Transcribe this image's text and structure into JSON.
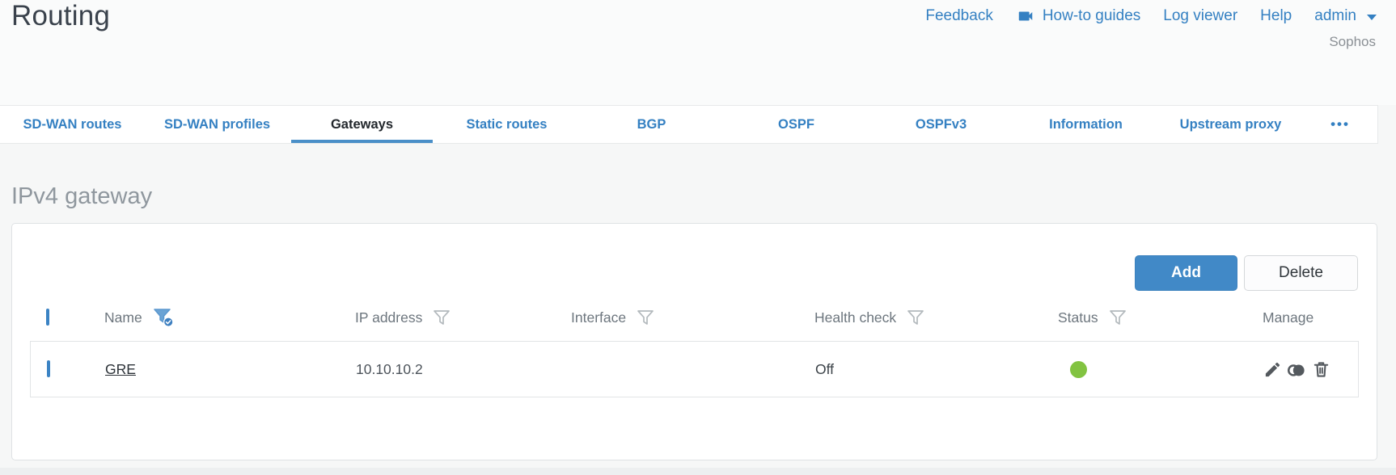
{
  "header": {
    "title": "Routing",
    "links": {
      "feedback": "Feedback",
      "howto": "How-to guides",
      "logviewer": "Log viewer",
      "help": "Help"
    },
    "user": "admin",
    "brand": "Sophos"
  },
  "tabs": {
    "items": [
      {
        "label": "SD-WAN routes",
        "active": false
      },
      {
        "label": "SD-WAN profiles",
        "active": false
      },
      {
        "label": "Gateways",
        "active": true
      },
      {
        "label": "Static routes",
        "active": false
      },
      {
        "label": "BGP",
        "active": false
      },
      {
        "label": "OSPF",
        "active": false
      },
      {
        "label": "OSPFv3",
        "active": false
      },
      {
        "label": "Information",
        "active": false
      },
      {
        "label": "Upstream proxy",
        "active": false
      }
    ],
    "more": "•••"
  },
  "section_title": "IPv4 gateway",
  "toolbar": {
    "add_label": "Add",
    "delete_label": "Delete"
  },
  "table": {
    "columns": [
      {
        "label": "Name",
        "filter": "active"
      },
      {
        "label": "IP address",
        "filter": "default"
      },
      {
        "label": "Interface",
        "filter": "default"
      },
      {
        "label": "Health check",
        "filter": "default"
      },
      {
        "label": "Status",
        "filter": "default"
      },
      {
        "label": "Manage",
        "filter": "none"
      }
    ],
    "rows": [
      {
        "name": "GRE",
        "ip_address": "10.10.10.2",
        "interface": "",
        "health_check": "Off",
        "status": "up"
      }
    ]
  },
  "icons": {
    "videocam": "video-camera glyph",
    "caret_down": "dropdown caret",
    "filter": "funnel outline",
    "filter_active": "blue funnel with check badge",
    "edit": "pencil",
    "clone": "overlapping circles",
    "trash": "trash can"
  },
  "colors": {
    "accent_blue": "#3480c2",
    "button_blue": "#4189c7",
    "tab_underline": "#4a8fc8",
    "status_green": "#82c341",
    "title_gray": "#8f979e"
  }
}
